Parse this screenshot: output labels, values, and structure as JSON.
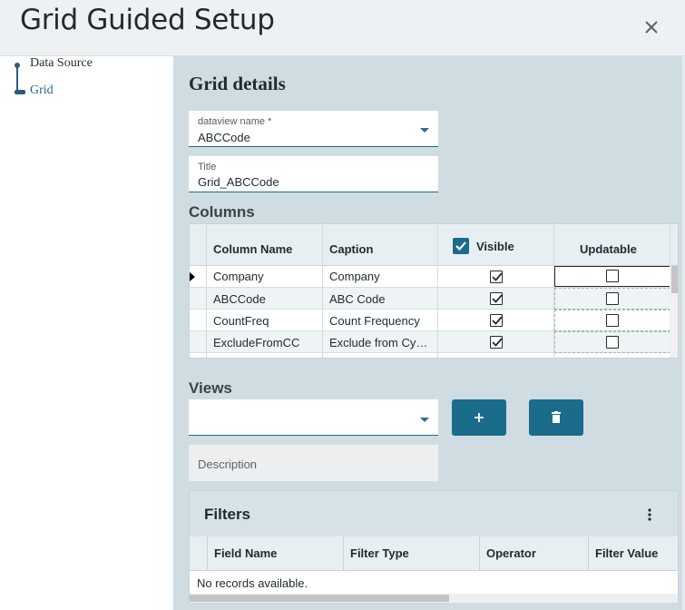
{
  "header": {
    "title": "Grid Guided Setup"
  },
  "steps": [
    {
      "label": "Data Source"
    },
    {
      "label": "Grid"
    }
  ],
  "grid_details": {
    "title": "Grid details",
    "dataview": {
      "label": "dataview name *",
      "value": "ABCCode"
    },
    "title_field": {
      "label": "Title",
      "value": "Grid_ABCCode"
    }
  },
  "columns": {
    "title": "Columns",
    "headers": [
      "Column Name",
      "Caption",
      "Visible",
      "Updatable"
    ],
    "rows": [
      {
        "name": "Company",
        "caption": "Company",
        "visible": true,
        "updatable": false
      },
      {
        "name": "ABCCode",
        "caption": "ABC Code",
        "visible": true,
        "updatable": false
      },
      {
        "name": "CountFreq",
        "caption": "Count Frequency",
        "visible": true,
        "updatable": false
      },
      {
        "name": "ExcludeFromCC",
        "caption": "Exclude from Cy…",
        "visible": true,
        "updatable": false
      }
    ]
  },
  "views": {
    "title": "Views",
    "value": "",
    "description_placeholder": "Description"
  },
  "filters": {
    "title": "Filters",
    "headers": [
      "Field Name",
      "Filter Type",
      "Operator",
      "Filter Value"
    ],
    "empty_text": "No records available."
  }
}
